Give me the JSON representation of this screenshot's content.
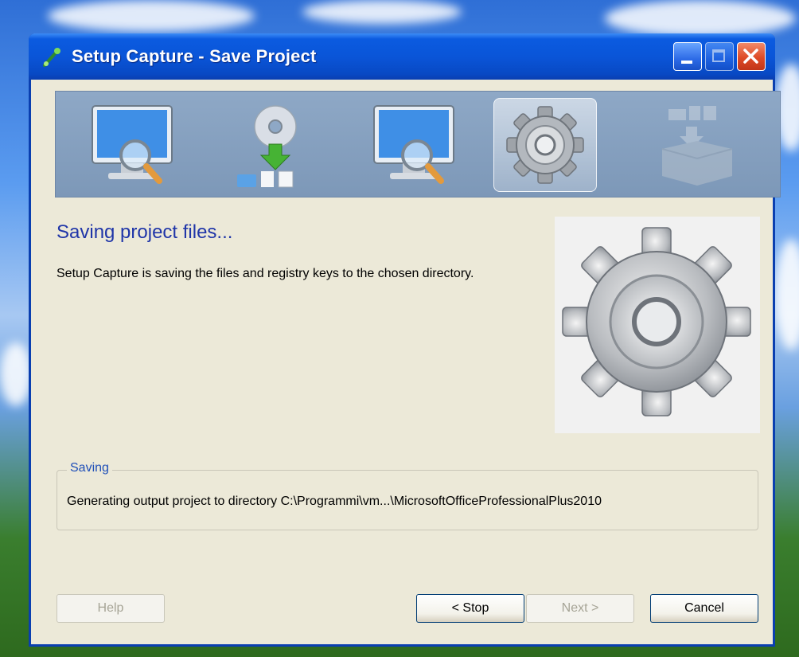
{
  "window": {
    "title": "Setup Capture - Save Project"
  },
  "wizard": {
    "steps": [
      {
        "icon": "monitor-search-icon",
        "active": false
      },
      {
        "icon": "cd-download-icon",
        "active": false
      },
      {
        "icon": "monitor-search-icon",
        "active": false
      },
      {
        "icon": "gear-icon",
        "active": true
      },
      {
        "icon": "box-files-icon",
        "active": false
      }
    ]
  },
  "content": {
    "heading": "Saving project files...",
    "description": "Setup Capture is saving the files and registry keys to the chosen directory."
  },
  "saving_group": {
    "label": "Saving",
    "status": "Generating output project to directory C:\\Programmi\\vm...\\MicrosoftOfficeProfessionalPlus2010"
  },
  "buttons": {
    "help": "Help",
    "stop": "< Stop",
    "next": "Next >",
    "cancel": "Cancel"
  },
  "colors": {
    "titlebar": "#0a55d8",
    "heading": "#1f35a8",
    "group_label": "#1f4fb8"
  }
}
